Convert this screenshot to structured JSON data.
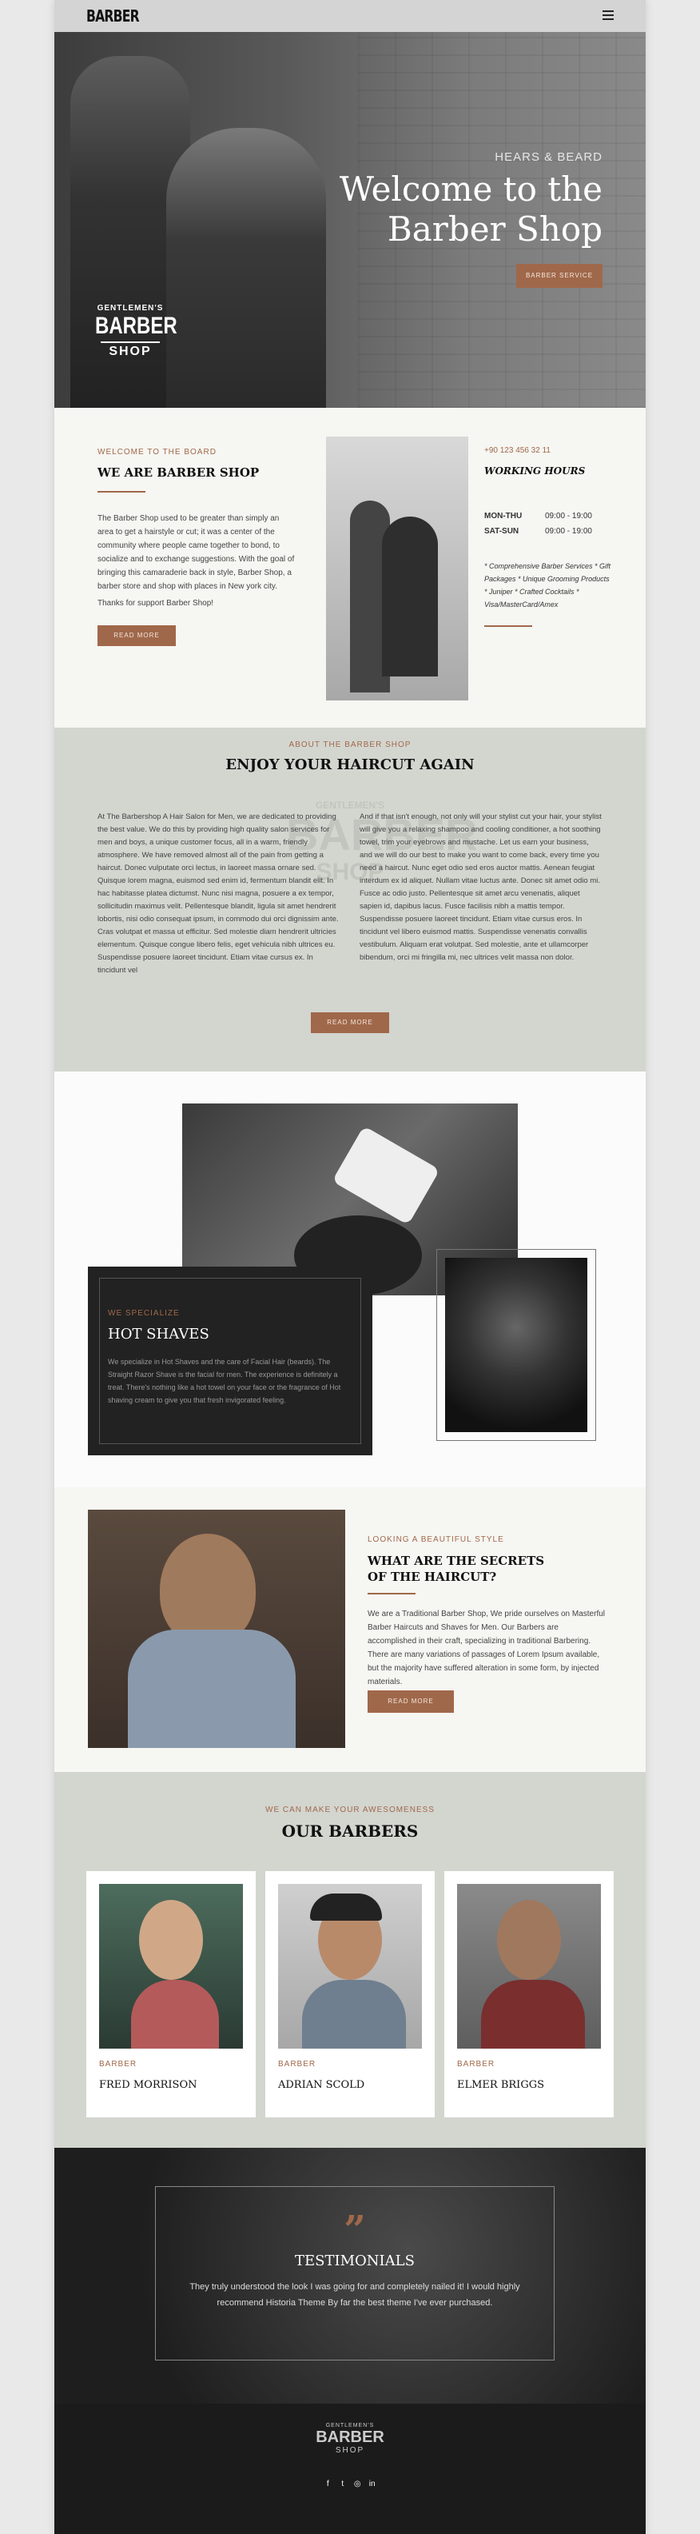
{
  "header": {
    "logo": "BARBER",
    "menu_icon": "hamburger-icon"
  },
  "hero": {
    "subtitle": "HEARS & BEARD",
    "title": "Welcome to the Barber Shop",
    "button": "BARBER SERVICE",
    "badge": {
      "line1": "GENTLEMEN'S",
      "line2": "BARBER",
      "line3": "SHOP"
    }
  },
  "about": {
    "eyebrow": "WELCOME TO THE BOARD",
    "title": "WE ARE BARBER SHOP",
    "paragraph1": "The Barber Shop used to be greater than simply an area to get a hairstyle or cut; it was a center of the community where people came together to bond, to socialize and to exchange suggestions. With the goal of bringing this camaraderie back in style, Barber Shop, a barber store and shop with places in New york city.",
    "paragraph2": "Thanks for support Barber Shop!",
    "button": "READ MORE",
    "phone": "+90 123 456 32 11",
    "hours_title": "WORKING HOURS",
    "hours": [
      {
        "day": "MON-THU",
        "time": "09:00 - 19:00"
      },
      {
        "day": "SAT-SUN",
        "time": "09:00 - 19:00"
      }
    ],
    "services": "* Comprehensive Barber Services * Gift Packages * Unique Grooming Products * Juniper * Crafted Cocktails * Visa/MasterCard/Amex"
  },
  "haircut": {
    "eyebrow": "ABOUT THE BARBER SHOP",
    "title": "ENJOY YOUR HAIRCUT AGAIN",
    "col1": "At The Barbershop A Hair Salon for Men, we are dedicated to providing the best value. We do this by providing high quality salon services for men and boys, a unique customer focus, all in a warm, friendly atmosphere. We have removed almost all of the pain from getting a haircut. Donec vulputate orci lectus, in laoreet massa ornare sed. Quisque lorem magna, euismod sed enim id, fermentum blandit elit. In hac habitasse platea dictumst. Nunc nisi magna, posuere a ex tempor, sollicitudin maximus velit. Pellentesque blandit, ligula sit amet hendrerit lobortis, nisi odio consequat ipsum, in commodo dui orci dignissim ante. Cras volutpat et massa ut efficitur. Sed molestie diam hendrerit ultricies elementum. Quisque congue libero felis, eget vehicula nibh ultrices eu. Suspendisse posuere laoreet tincidunt. Etiam vitae cursus ex. In tincidunt vel",
    "col2": "And if that isn't enough, not only will your stylist cut your hair, your stylist will give you a relaxing shampoo and cooling conditioner, a hot soothing towel, trim your eyebrows and mustache. Let us earn your business, and we will do our best to make you want to come back, every time you need a haircut. Nunc eget odio sed eros auctor mattis. Aenean feugiat interdum ex id aliquet. Nullam vitae luctus ante. Donec sit amet odio mi. Fusce ac odio justo. Pellentesque sit amet arcu venenatis, aliquet sapien id, dapibus lacus. Fusce facilisis nibh a mattis tempor. Suspendisse posuere laoreet tincidunt. Etiam vitae cursus eros. In tincidunt vel libero euismod mattis. Suspendisse venenatis convallis vestibulum. Aliquam erat volutpat. Sed molestie, ante et ullamcorper bibendum, orci mi fringilla mi, nec ultrices velit massa non dolor.",
    "button": "READ MORE"
  },
  "shaves": {
    "eyebrow": "WE SPECIALIZE",
    "title": "HOT SHAVES",
    "text": "We specialize in Hot Shaves and the care of Facial Hair (beards). The Straight Razor Shave is the facial for men. The experience is definitely a treat. There's nothing like a hot towel on your face or the fragrance of Hot shaving cream to give you that fresh invigorated feeling."
  },
  "secrets": {
    "eyebrow": "LOOKING A BEAUTIFUL STYLE",
    "title": "WHAT ARE THE SECRETS OF THE HAIRCUT?",
    "text": "We are a Traditional Barber Shop, We pride ourselves on Masterful Barber Haircuts and Shaves for Men. Our Barbers are accomplished in their craft, specializing in traditional Barbering. There are many variations of passages of Lorem Ipsum available, but the majority have suffered alteration in some form, by injected materials.",
    "button": "READ MORE"
  },
  "barbers": {
    "eyebrow": "WE CAN MAKE YOUR AWESOMENESS",
    "title": "OUR BARBERS",
    "items": [
      {
        "role": "BARBER",
        "name": "FRED MORRISON"
      },
      {
        "role": "BARBER",
        "name": "ADRIAN SCOLD"
      },
      {
        "role": "BARBER",
        "name": "ELMER BRIGGS"
      }
    ]
  },
  "testimonials": {
    "quote_mark": "”",
    "title": "TESTIMONIALS",
    "text": "They truly understood the look I was going for and completely nailed it! I would highly recommend Historia Theme By far the best theme I've ever purchased."
  },
  "footer": {
    "badge": {
      "line1": "GENTLEMEN'S",
      "line2": "BARBER",
      "line3": "SHOP"
    },
    "social": [
      {
        "icon": "facebook-icon",
        "glyph": "f"
      },
      {
        "icon": "twitter-icon",
        "glyph": "t"
      },
      {
        "icon": "instagram-icon",
        "glyph": "◎"
      },
      {
        "icon": "linkedin-icon",
        "glyph": "in"
      }
    ]
  }
}
